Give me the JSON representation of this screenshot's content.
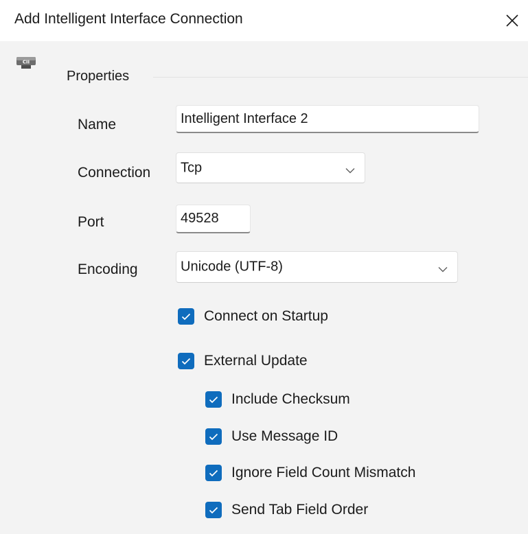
{
  "window": {
    "title": "Add Intelligent Interface Connection",
    "close_icon": "close-icon",
    "app_icon": "connector-icon",
    "app_icon_text": "CII"
  },
  "properties": {
    "group_label": "Properties",
    "name": {
      "label": "Name",
      "value": "Intelligent Interface 2"
    },
    "connection": {
      "label": "Connection",
      "value": "Tcp"
    },
    "port": {
      "label": "Port",
      "value": "49528"
    },
    "encoding": {
      "label": "Encoding",
      "value": "Unicode (UTF-8)"
    },
    "connect_on_startup": {
      "label": "Connect on Startup",
      "checked": true
    },
    "external_update": {
      "label": "External Update",
      "checked": true
    },
    "include_checksum": {
      "label": "Include Checksum",
      "checked": true
    },
    "use_message_id": {
      "label": "Use Message ID",
      "checked": true
    },
    "ignore_field_count_mismatch": {
      "label": "Ignore Field Count Mismatch",
      "checked": true
    },
    "send_tab_field_order": {
      "label": "Send Tab Field Order",
      "checked": true
    }
  },
  "colors": {
    "accent": "#0f6cbd",
    "window_background": "#f3f3f3",
    "titlebar_background": "#ffffff"
  }
}
